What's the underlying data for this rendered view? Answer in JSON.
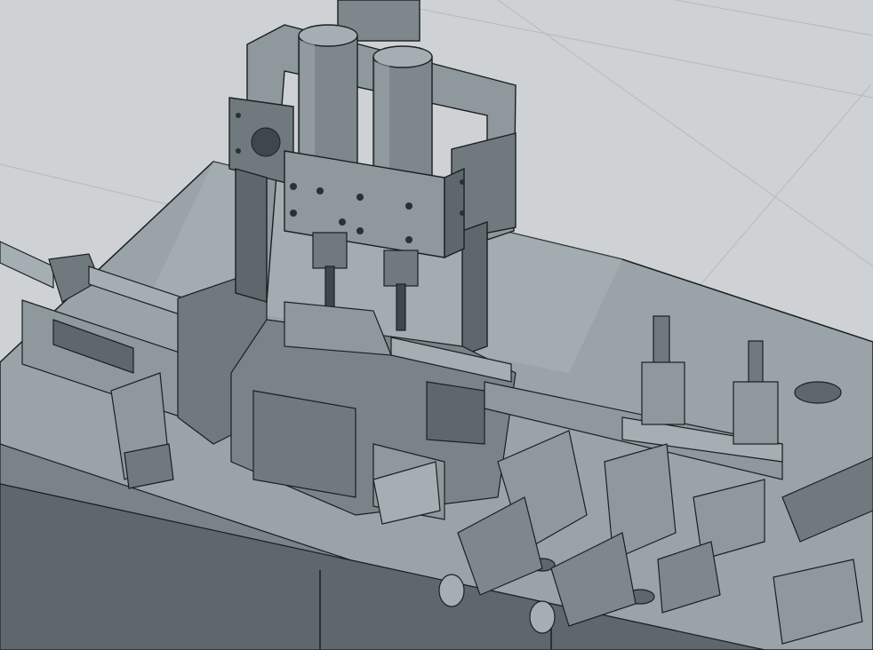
{
  "scene": {
    "description_visible_text": "",
    "colors": {
      "background": "#cfd2d4",
      "floor_grid": "#b9bdbf",
      "table_top": "#9aa3a8",
      "table_top_light": "#aab2b6",
      "table_side": "#5e676c",
      "metal_dark": "#3f474c",
      "metal_mid": "#6f797e",
      "metal_light": "#8e989d",
      "cylinder": "#7d878c",
      "cylinder_light": "#a5aeb2",
      "edge": "#1b1f22"
    },
    "icons": [
      "motor-icon",
      "cylinder-icon",
      "bolt-hole-icon"
    ]
  }
}
